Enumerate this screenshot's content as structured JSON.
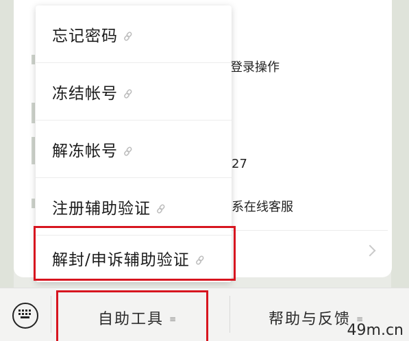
{
  "background": {
    "text_login": "登录操作",
    "text_number": "27",
    "text_service": "系在线客服"
  },
  "menu": {
    "items": [
      {
        "label": "忘记密码"
      },
      {
        "label": "冻结帐号"
      },
      {
        "label": "解冻帐号"
      },
      {
        "label": "注册辅助验证"
      },
      {
        "label": "解封/申诉辅助验证"
      }
    ]
  },
  "bottom_bar": {
    "tab_self_service": "自助工具",
    "tab_help": "帮助与反馈"
  },
  "watermark": "49m.cn",
  "colors": {
    "highlight": "#d7151f",
    "bar_background": "#f3f3f2"
  }
}
